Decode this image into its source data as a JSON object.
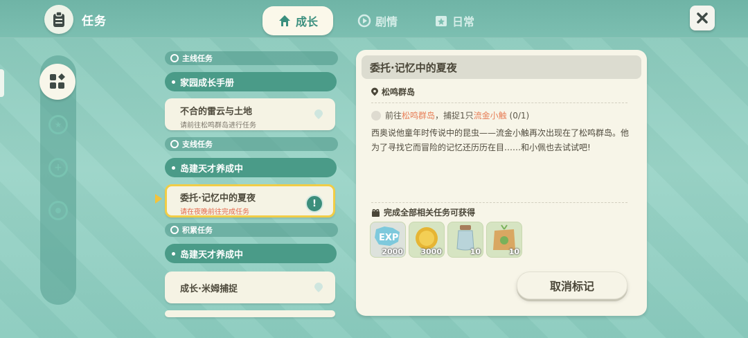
{
  "header": {
    "title": "任务",
    "title_icon": "clipboard-icon",
    "tabs": [
      {
        "label": "成长",
        "icon": "house-icon",
        "active": true
      },
      {
        "label": "剧情",
        "icon": "play-icon",
        "active": false
      },
      {
        "label": "日常",
        "icon": "calendar-star-icon",
        "active": false
      }
    ],
    "close_icon": "close-icon"
  },
  "sidebar": {
    "items": [
      {
        "icon": "grid-icon",
        "active": true
      },
      {
        "icon": "star-badge-icon",
        "active": false
      },
      {
        "icon": "plus-badge-icon",
        "active": false
      },
      {
        "icon": "dot-badge-icon",
        "active": false
      }
    ]
  },
  "quest_list": {
    "sections": [
      {
        "label": "主线任务"
      },
      {
        "label": "支线任务"
      },
      {
        "label": "积累任务"
      }
    ],
    "items": [
      {
        "title": "家园成长手册"
      },
      {
        "title": "不合的雷云与土地",
        "subtitle": "请前往松鸣群岛进行任务"
      },
      {
        "title": "岛建天才养成中"
      },
      {
        "title": "委托·记忆中的夏夜",
        "subtitle": "请在夜晚前往完成任务",
        "selected": true
      },
      {
        "title": "岛建天才养成中"
      },
      {
        "title": "成长·米姆捕捉"
      }
    ]
  },
  "detail": {
    "title": "委托·记忆中的夏夜",
    "location": "松鸣群岛",
    "objective": {
      "prefix": "前往",
      "place": "松鸣群岛",
      "middle": "，捕捉1只",
      "target": "流金小触",
      "progress": "(0/1)"
    },
    "description": "西奥说他童年时传说中的昆虫——流金小触再次出现在了松鸣群岛。他为了寻找它而冒险的记忆还历历在目……和小佩也去试试吧!",
    "reward_title": "完成全部相关任务可获得",
    "rewards": [
      {
        "icon": "exp-icon",
        "count": "2000"
      },
      {
        "icon": "gold-coin-icon",
        "count": "3000"
      },
      {
        "icon": "jar-icon",
        "count": "10"
      },
      {
        "icon": "seed-bag-icon",
        "count": "10"
      }
    ],
    "unmark_button": "取消标记"
  },
  "colors": {
    "accent": "#3a8f7e",
    "highlight": "#e77e57",
    "selected_border": "#f1cd46"
  }
}
